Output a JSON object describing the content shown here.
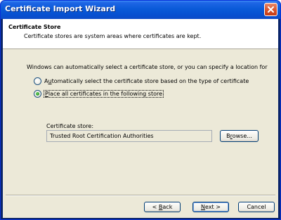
{
  "window": {
    "title": "Certificate Import Wizard",
    "close_icon": "close-icon",
    "close_color": "#d9562f"
  },
  "header": {
    "title": "Certificate Store",
    "subtitle": "Certificate stores are system areas where certificates are kept."
  },
  "main": {
    "intro": "Windows can automatically select a certificate store, or you can specify a location for",
    "options": [
      {
        "label": "Automatically select the certificate store based on the type of certificate",
        "accesskey": "U",
        "checked": false
      },
      {
        "label": "Place all certificates in the following store",
        "accesskey": "P",
        "checked": true
      }
    ],
    "store_label": "Certificate store:",
    "store_value": "Trusted Root Certification Authorities",
    "browse_label": "Browse...",
    "browse_accesskey": "R"
  },
  "footer": {
    "back_label": "< Back",
    "back_accesskey": "B",
    "next_label": "Next >",
    "next_accesskey": "N",
    "cancel_label": "Cancel"
  }
}
